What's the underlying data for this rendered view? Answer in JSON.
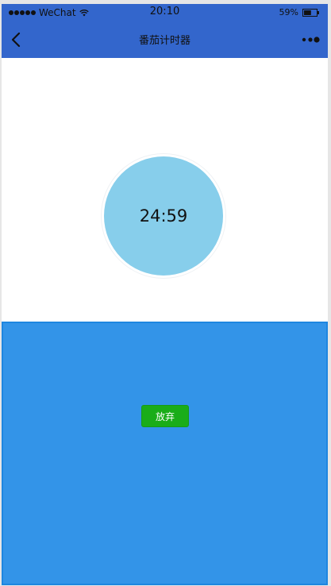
{
  "status_bar": {
    "carrier": "WeChat",
    "time": "20:10",
    "battery": "59%",
    "battery_level": 0.59
  },
  "nav": {
    "title": "番茄计时器",
    "back_icon": "chevron-left-icon",
    "more_icon": "more-dots-icon"
  },
  "timer": {
    "display": "24:59"
  },
  "controls": {
    "give_up_label": "放弃"
  },
  "colors": {
    "nav_background": "#3366cc",
    "timer_circle": "#87ceeb",
    "panel_background": "#3394e8",
    "button_green": "#1aad19"
  }
}
